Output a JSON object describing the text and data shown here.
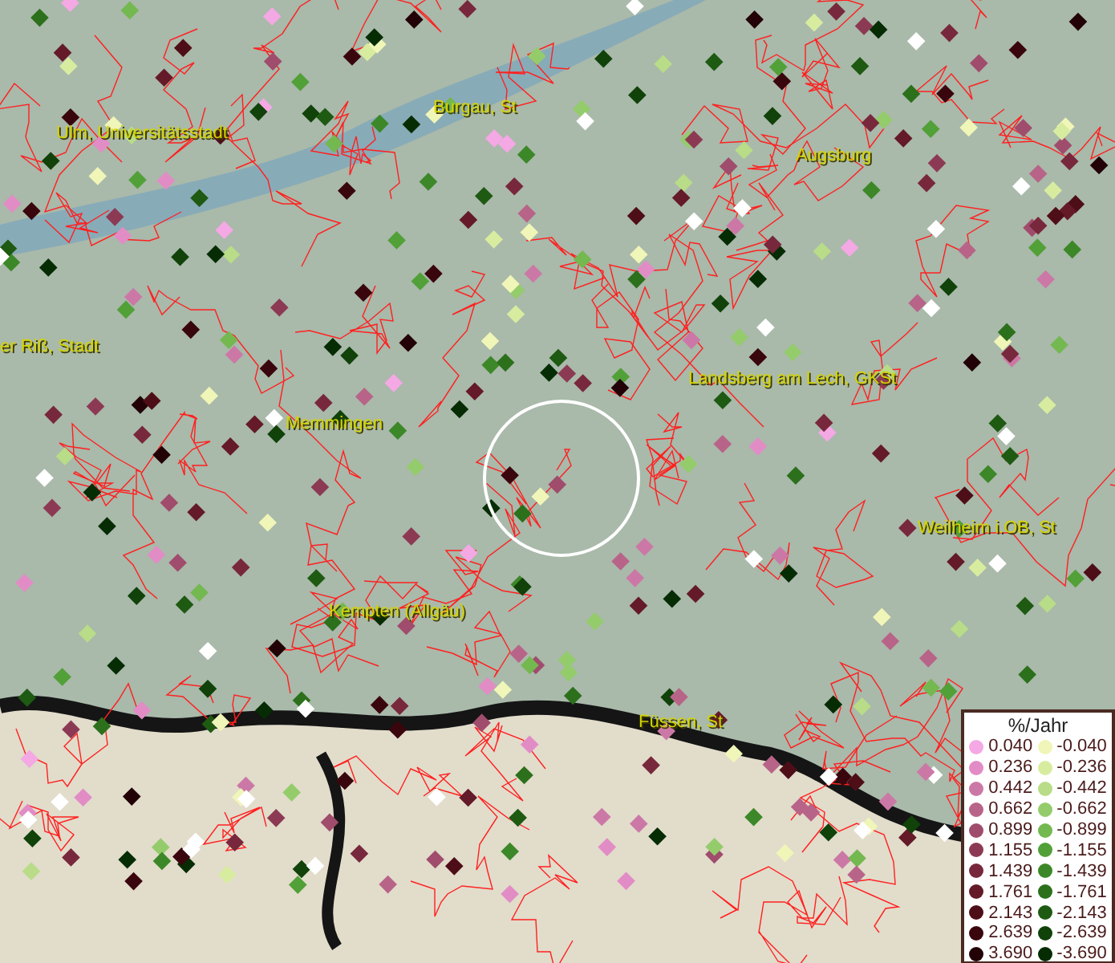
{
  "map": {
    "places": [
      {
        "name": "Ulm, Universitätsstadt"
      },
      {
        "name": "Burgau, St"
      },
      {
        "name": "Augsburg"
      },
      {
        "name": "er Riß, Stadt"
      },
      {
        "name": "Landsberg am Lech, GKSt"
      },
      {
        "name": "Memmingen"
      },
      {
        "name": "Weilheim i.OB, St"
      },
      {
        "name": "Kempten (Allgäu)"
      },
      {
        "name": "Füssen, St"
      }
    ]
  },
  "legend": {
    "title": "%/Jahr",
    "columns": [
      [
        {
          "value": "0.040",
          "color": "#f4a8e4"
        },
        {
          "value": "0.236",
          "color": "#e28cc6"
        },
        {
          "value": "0.442",
          "color": "#cc78a6"
        },
        {
          "value": "0.662",
          "color": "#b86488"
        },
        {
          "value": "0.899",
          "color": "#a04c6c"
        },
        {
          "value": "1.155",
          "color": "#8c3a54"
        },
        {
          "value": "1.439",
          "color": "#78283c"
        },
        {
          "value": "1.761",
          "color": "#641a28"
        },
        {
          "value": "2.143",
          "color": "#4e0e18"
        },
        {
          "value": "2.639",
          "color": "#3a060e"
        },
        {
          "value": "3.690",
          "color": "#220206"
        }
      ],
      [
        {
          "value": "-0.040",
          "color": "#f0f5b8"
        },
        {
          "value": "-0.236",
          "color": "#d8eca0"
        },
        {
          "value": "-0.442",
          "color": "#b8dc88"
        },
        {
          "value": "-0.662",
          "color": "#94cc6c"
        },
        {
          "value": "-0.899",
          "color": "#74b850"
        },
        {
          "value": "-1.155",
          "color": "#52a038"
        },
        {
          "value": "-1.439",
          "color": "#3c8828"
        },
        {
          "value": "-1.761",
          "color": "#2c701c"
        },
        {
          "value": "-2.143",
          "color": "#1e5a12"
        },
        {
          "value": "-2.639",
          "color": "#10420a"
        },
        {
          "value": "-3.690",
          "color": "#062c04"
        }
      ]
    ]
  }
}
